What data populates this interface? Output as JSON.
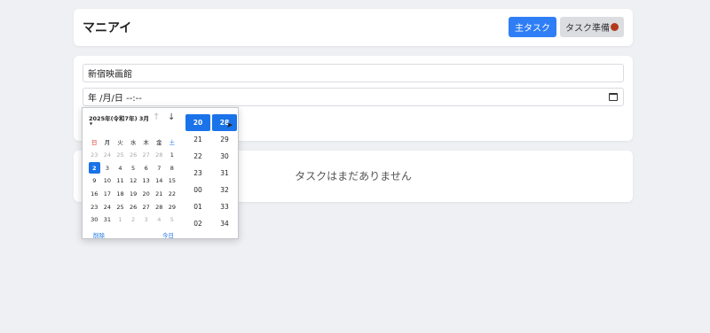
{
  "header": {
    "title": "マニアイ",
    "primary_button": "主タスク",
    "secondary_button": "タスク準備"
  },
  "form": {
    "title_value": "新宿映画館",
    "date_value": "年 /月/日 --:--"
  },
  "list": {
    "empty_message": "タスクはまだありません"
  },
  "datepicker": {
    "month_label": "2025年(令和7年) 3月",
    "weekdays": [
      "日",
      "月",
      "火",
      "水",
      "木",
      "金",
      "土"
    ],
    "days": [
      [
        "23",
        "24",
        "25",
        "26",
        "27",
        "28",
        "1"
      ],
      [
        "2",
        "3",
        "4",
        "5",
        "6",
        "7",
        "8"
      ],
      [
        "9",
        "10",
        "11",
        "12",
        "13",
        "14",
        "15"
      ],
      [
        "16",
        "17",
        "18",
        "19",
        "20",
        "21",
        "22"
      ],
      [
        "23",
        "24",
        "25",
        "26",
        "27",
        "28",
        "29"
      ],
      [
        "30",
        "31",
        "1",
        "2",
        "3",
        "4",
        "5"
      ]
    ],
    "selected_day": "2",
    "clear_label": "削除",
    "today_label": "今日",
    "hours": [
      "20",
      "21",
      "22",
      "23",
      "00",
      "01",
      "02"
    ],
    "minutes": [
      "28",
      "29",
      "30",
      "31",
      "32",
      "33",
      "34"
    ],
    "selected_hour": "20",
    "selected_minute": "28"
  }
}
